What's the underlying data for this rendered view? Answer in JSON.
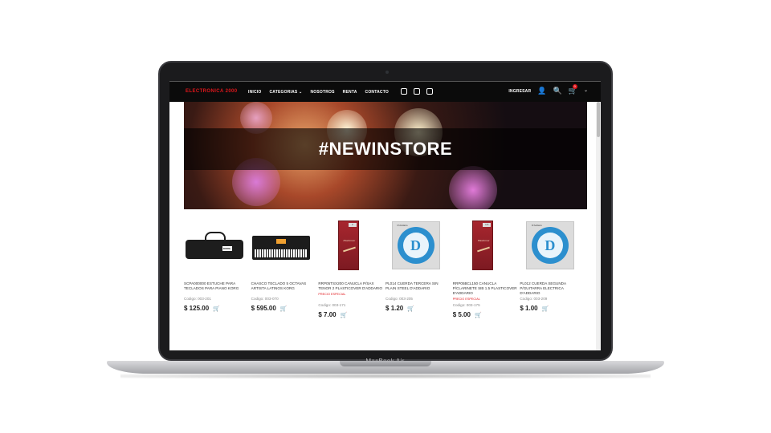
{
  "device": {
    "label": "MacBook Air"
  },
  "nav": {
    "logo": "ELECTRONICA 2000",
    "menu": [
      "INICIO",
      "CATEGORIAS ⌄",
      "NOSOTROS",
      "RENTA",
      "CONTACTO"
    ],
    "social_icons": [
      "whatsapp-icon",
      "facebook-icon",
      "instagram-icon"
    ],
    "login": "INGRESAR",
    "cart_count": "0"
  },
  "hero": {
    "title": "#NEWINSTORE"
  },
  "products": [
    {
      "name": "SCPA000000 ESTUCHE PARA TECLADOS PARA PIANO KORG",
      "badge": "",
      "code": "Codigo: 003-201",
      "price": "$ 125.00",
      "image": "keyboard-case"
    },
    {
      "name": "CHASCO TECLADO 5 OCTAVAS ARTISTA LATINOS KORG",
      "badge": "",
      "code": "Codigo: 003-070",
      "price": "$ 595.00",
      "image": "keyboard"
    },
    {
      "name": "RRP05TSX200 CANUCLA P/SAX TENOR 2 PLASTICOVER D'ADDARIO",
      "badge": "PRECIO ESPECIAL",
      "code": "Codigo: 003-171",
      "price": "$ 7.00",
      "image": "reed"
    },
    {
      "name": "PL014 CUERDA TERCERA SIN PLAIN STEEL D'ADDARIO",
      "badge": "",
      "code": "Codigo: 003-205",
      "price": "$ 1.20",
      "image": "string"
    },
    {
      "name": "RRP05BCL150 CANUCLA P/CLARINETE SIB 1.5 PLASTICOVER D'ADDARIO",
      "badge": "PRECIO ESPECIAL",
      "code": "Codigo: 003-175",
      "price": "$ 5.00",
      "image": "reed"
    },
    {
      "name": "PL012 CUERDA SEGUNDA P/GUITARRA ELECTRICA D'ADDARIO",
      "badge": "",
      "code": "Codigo: 003-209",
      "price": "$ 1.00",
      "image": "string"
    }
  ]
}
